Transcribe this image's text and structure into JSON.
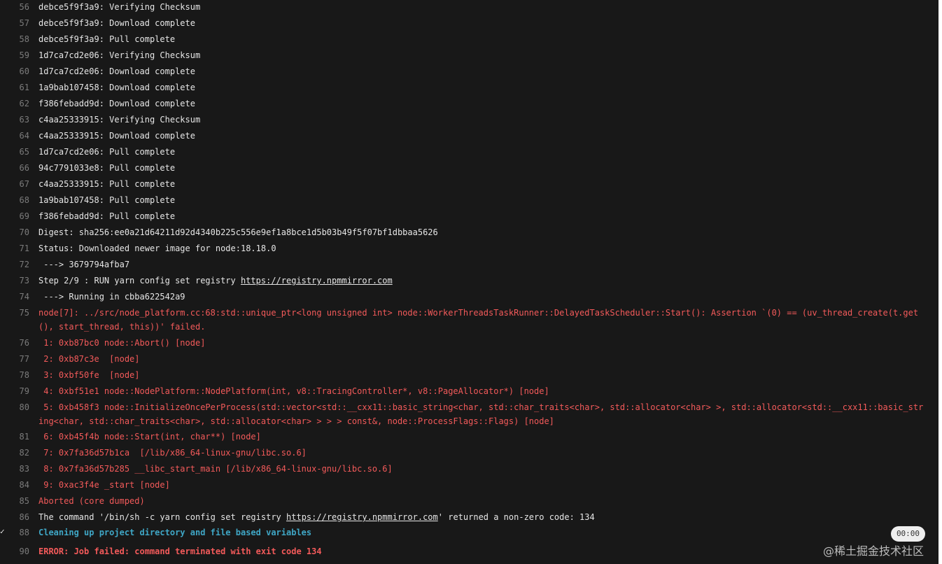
{
  "log": {
    "lines": [
      {
        "n": "56",
        "t": "debce5f9f3a9: Verifying Checksum"
      },
      {
        "n": "57",
        "t": "debce5f9f3a9: Download complete"
      },
      {
        "n": "58",
        "t": "debce5f9f3a9: Pull complete"
      },
      {
        "n": "59",
        "t": "1d7ca7cd2e06: Verifying Checksum"
      },
      {
        "n": "60",
        "t": "1d7ca7cd2e06: Download complete"
      },
      {
        "n": "61",
        "t": "1a9bab107458: Download complete"
      },
      {
        "n": "62",
        "t": "f386febadd9d: Download complete"
      },
      {
        "n": "63",
        "t": "c4aa25333915: Verifying Checksum"
      },
      {
        "n": "64",
        "t": "c4aa25333915: Download complete"
      },
      {
        "n": "65",
        "t": "1d7ca7cd2e06: Pull complete"
      },
      {
        "n": "66",
        "t": "94c7791033e8: Pull complete"
      },
      {
        "n": "67",
        "t": "c4aa25333915: Pull complete"
      },
      {
        "n": "68",
        "t": "1a9bab107458: Pull complete"
      },
      {
        "n": "69",
        "t": "f386febadd9d: Pull complete"
      },
      {
        "n": "70",
        "t": "Digest: sha256:ee0a21d64211d92d4340b225c556e9ef1a8bce1d5b03b49f5f07bf1dbbaa5626"
      },
      {
        "n": "71",
        "t": "Status: Downloaded newer image for node:18.18.0"
      },
      {
        "n": "72",
        "t": " ---> 3679794afba7"
      },
      {
        "n": "73",
        "t": "Step 2/9 : RUN yarn config set registry ",
        "link": "https://registry.npmmirror.com",
        "after": ""
      },
      {
        "n": "74",
        "t": " ---> Running in cbba622542a9"
      },
      {
        "n": "75",
        "t": "node[7]: ../src/node_platform.cc:68:std::unique_ptr<long unsigned int> node::WorkerThreadsTaskRunner::DelayedTaskScheduler::Start(): Assertion `(0) == (uv_thread_create(t.get(), start_thread, this))' failed.",
        "style": "err"
      },
      {
        "n": "76",
        "t": " 1: 0xb87bc0 node::Abort() [node]",
        "style": "err"
      },
      {
        "n": "77",
        "t": " 2: 0xb87c3e  [node]",
        "style": "err"
      },
      {
        "n": "78",
        "t": " 3: 0xbf50fe  [node]",
        "style": "err"
      },
      {
        "n": "79",
        "t": " 4: 0xbf51e1 node::NodePlatform::NodePlatform(int, v8::TracingController*, v8::PageAllocator*) [node]",
        "style": "err"
      },
      {
        "n": "80",
        "t": " 5: 0xb458f3 node::InitializeOncePerProcess(std::vector<std::__cxx11::basic_string<char, std::char_traits<char>, std::allocator<char> >, std::allocator<std::__cxx11::basic_string<char, std::char_traits<char>, std::allocator<char> > > > const&, node::ProcessFlags::Flags) [node]",
        "style": "err"
      },
      {
        "n": "81",
        "t": " 6: 0xb45f4b node::Start(int, char**) [node]",
        "style": "err"
      },
      {
        "n": "82",
        "t": " 7: 0x7fa36d57b1ca  [/lib/x86_64-linux-gnu/libc.so.6]",
        "style": "err"
      },
      {
        "n": "83",
        "t": " 8: 0x7fa36d57b285 __libc_start_main [/lib/x86_64-linux-gnu/libc.so.6]",
        "style": "err"
      },
      {
        "n": "84",
        "t": " 9: 0xac3f4e _start [node]",
        "style": "err"
      },
      {
        "n": "85",
        "t": "Aborted (core dumped)",
        "style": "err"
      },
      {
        "n": "86",
        "t": "The command '/bin/sh -c yarn config set registry ",
        "link": "https://registry.npmmirror.com",
        "after": "' returned a non-zero code: 134"
      },
      {
        "n": "88",
        "t": "Cleaning up project directory and file based variables",
        "style": "sec"
      },
      {
        "n": "90",
        "t": "ERROR: Job failed: command terminated with exit code 134",
        "style": "fail"
      }
    ]
  },
  "section_duration": "00:00",
  "watermark": "@稀土掘金技术社区"
}
